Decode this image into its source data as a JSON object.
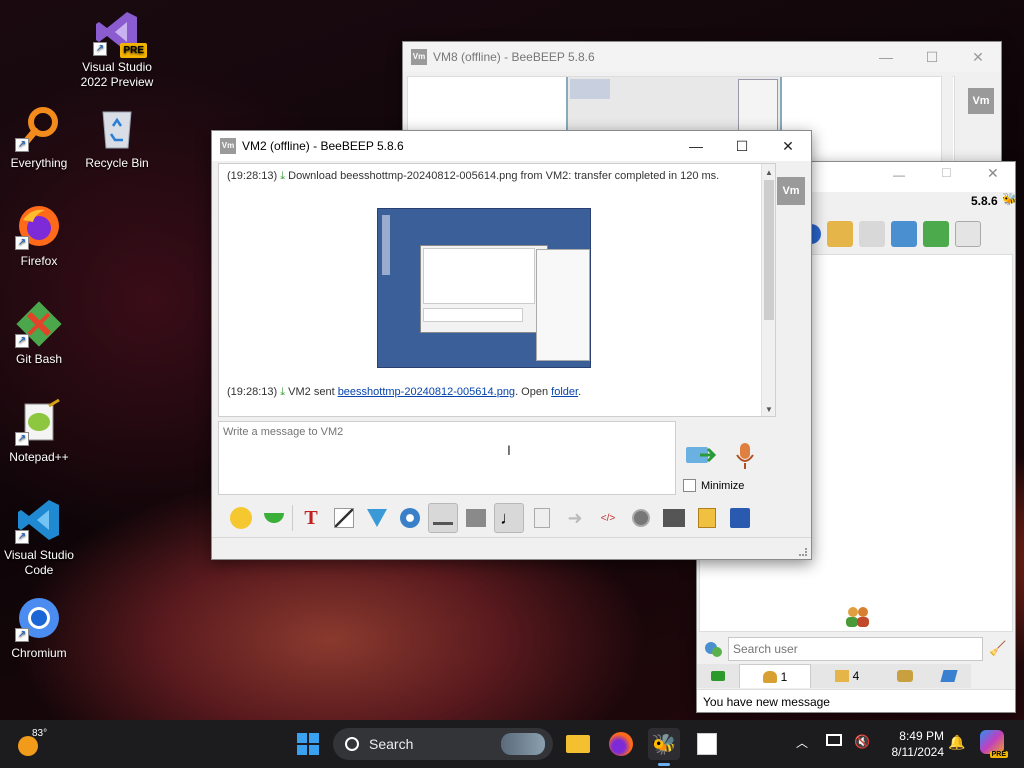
{
  "desktop": {
    "icons": [
      {
        "label": "Visual Studio 2022 Preview",
        "badge": "PRE"
      },
      {
        "label": "Everything"
      },
      {
        "label": "Recycle Bin"
      },
      {
        "label": "Firefox"
      },
      {
        "label": "Git Bash"
      },
      {
        "label": "Notepad++"
      },
      {
        "label": "Visual Studio Code"
      },
      {
        "label": "Chromium"
      }
    ]
  },
  "vm8": {
    "title": "VM8 (offline) - BeeBEEP 5.8.6",
    "badge": "Vm"
  },
  "main": {
    "version": "5.8.6",
    "search_placeholder": "Search user",
    "tabs": [
      {
        "label": "1"
      },
      {
        "label": "4"
      }
    ],
    "status": "You have new message"
  },
  "vm2": {
    "title": "VM2 (offline) - BeeBEEP 5.8.6",
    "badge": "Vm",
    "messages": {
      "m1_time": "(19:28:13)",
      "m1_text": "Download beesshottmp-20240812-005614.png from VM2: transfer completed in 120 ms.",
      "m2_time": "(19:28:13)",
      "m2_prefix": "VM2 sent",
      "m2_file": "beesshottmp-20240812-005614.png",
      "m2_mid": ". Open",
      "m2_folder": "folder",
      "m2_end": "."
    },
    "compose_placeholder": "Write a message to VM2",
    "minimize_label": "Minimize",
    "minimize_checked": false
  },
  "taskbar": {
    "weather_temp": "83°",
    "search_label": "Search",
    "time": "8:49 PM",
    "date": "8/11/2024",
    "copilot_badge": "PRE"
  },
  "colors": {
    "taskbar_bg": "#1c1c1e",
    "link": "#0645ad",
    "title_bg": "#ffffff"
  }
}
